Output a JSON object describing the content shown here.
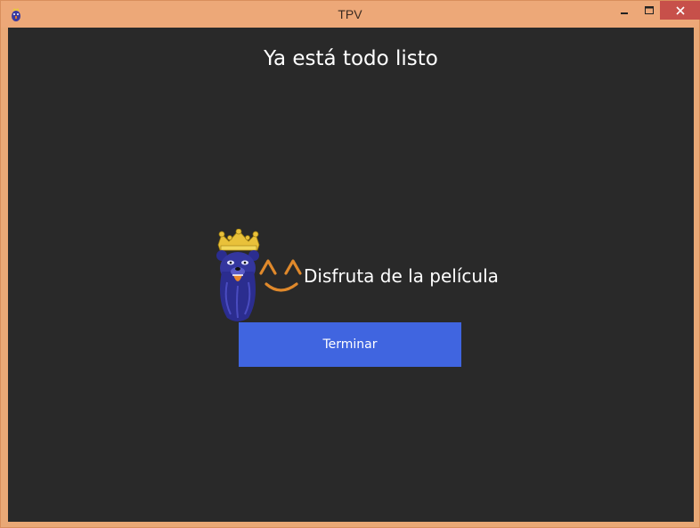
{
  "window": {
    "title": "TPV",
    "title_bar_color": "#eda878",
    "icon": "crowned-bear-icon",
    "controls": {
      "minimize_icon": "minimize-icon",
      "maximize_icon": "maximize-icon",
      "close_icon": "close-icon"
    }
  },
  "main": {
    "background_color": "#292929",
    "heading": "Ya está todo listo",
    "mascot_icon": "crowned-bear-mascot",
    "emoticon": "^ ^",
    "emoticon_color": "#e0892b",
    "message": "Disfruta de la película",
    "finish_button": {
      "label": "Terminar",
      "color": "#4065e0"
    }
  }
}
